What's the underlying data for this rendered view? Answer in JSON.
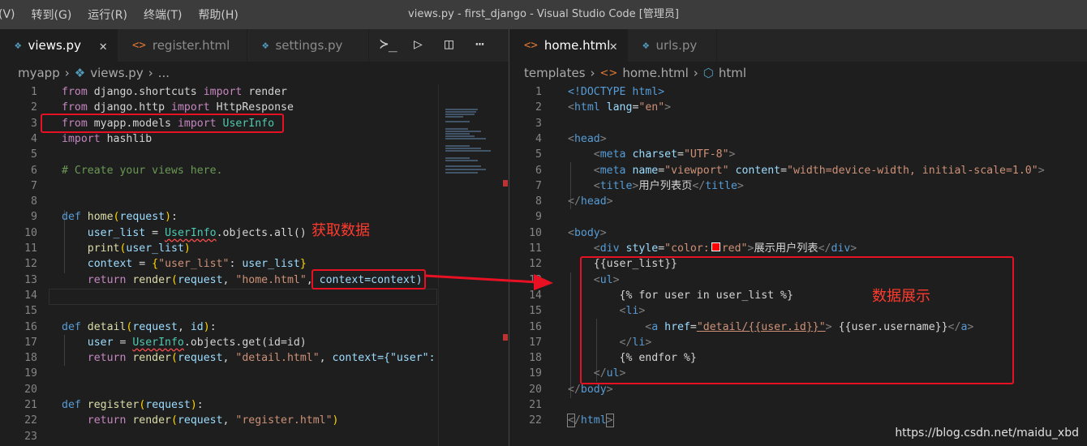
{
  "menu": [
    "(V)",
    "转到(G)",
    "运行(R)",
    "终端(T)",
    "帮助(H)"
  ],
  "window_title": "views.py - first_django - Visual Studio Code [管理员]",
  "left": {
    "tabs": [
      {
        "label": "views.py",
        "icon": "python-icon"
      },
      {
        "label": "register.html",
        "icon": "html-icon"
      },
      {
        "label": "settings.py",
        "icon": "python-icon"
      }
    ],
    "breadcrumb": [
      "myapp",
      "views.py",
      "..."
    ],
    "line_numbers": [
      "1",
      "2",
      "3",
      "4",
      "5",
      "6",
      "7",
      "8",
      "9",
      "10",
      "11",
      "12",
      "13",
      "14",
      "15",
      "16",
      "17",
      "18",
      "19",
      "20",
      "21",
      "22",
      "23"
    ]
  },
  "right": {
    "tabs": [
      {
        "label": "home.html",
        "icon": "html-icon"
      },
      {
        "label": "urls.py",
        "icon": "python-icon"
      }
    ],
    "breadcrumb": [
      "templates",
      "home.html",
      "html"
    ],
    "line_numbers": [
      "1",
      "2",
      "3",
      "4",
      "5",
      "6",
      "7",
      "8",
      "9",
      "10",
      "11",
      "12",
      "13",
      "14",
      "15",
      "16",
      "17",
      "18",
      "19",
      "20",
      "21",
      "22"
    ]
  },
  "code": {
    "l1": [
      "from",
      "django.shortcuts",
      "import",
      "render"
    ],
    "l2": [
      "from",
      "django.http",
      "import",
      "HttpResponse"
    ],
    "l3": [
      "from",
      "myapp.models",
      "import",
      "UserInfo"
    ],
    "l4": [
      "import",
      "hashlib"
    ],
    "l6": "# Create your views here.",
    "l9": [
      "def",
      "home",
      "request"
    ],
    "l10": [
      "user_list",
      "UserInfo",
      ".objects.all()"
    ],
    "l11": [
      "print",
      "user_list"
    ],
    "l12": [
      "context",
      "\"user_list\"",
      "user_list"
    ],
    "l13": [
      "return",
      "render",
      "request",
      "\"home.html\"",
      "context=context)"
    ],
    "l16": [
      "def",
      "detail",
      "request",
      "id"
    ],
    "l17": [
      "user",
      "UserInfo",
      ".objects.get(id=id)"
    ],
    "l18": [
      "return",
      "render",
      "request",
      "\"detail.html\"",
      "context={\"user\":"
    ],
    "l21": [
      "def",
      "register",
      "request"
    ],
    "l22": [
      "return",
      "render",
      "request",
      "\"register.html\""
    ]
  },
  "html_code": {
    "l1": "<!DOCTYPE html>",
    "l2": [
      "html",
      "lang",
      "\"en\""
    ],
    "l4": "head",
    "l5": [
      "meta",
      "charset",
      "\"UTF-8\""
    ],
    "l6": [
      "meta",
      "name",
      "\"viewport\"",
      "content",
      "\"width=device-width, initial-scale=1.0\""
    ],
    "l7": [
      "title",
      "用户列表页"
    ],
    "l8": "head",
    "l10": "body",
    "l11": [
      "div",
      "style",
      "\"color:",
      "red\"",
      "展示用户列表"
    ],
    "l12": "{{user_list}}",
    "l13": "ul",
    "l14": "{% for user in user_list %}",
    "l15": "li",
    "l16": [
      "a",
      "href",
      "\"detail/{{user.id}}\"",
      "{{user.username}}"
    ],
    "l17": "li",
    "l18": "{% endfor %}",
    "l19": "ul",
    "l20": "body",
    "l22": "html"
  },
  "annotations": {
    "get_data": "获取数据",
    "display_data": "数据展示"
  },
  "watermark": "https://blog.csdn.net/maidu_xbd",
  "colors": {
    "annotation": "#ff3b2f",
    "box": "#e81123"
  }
}
